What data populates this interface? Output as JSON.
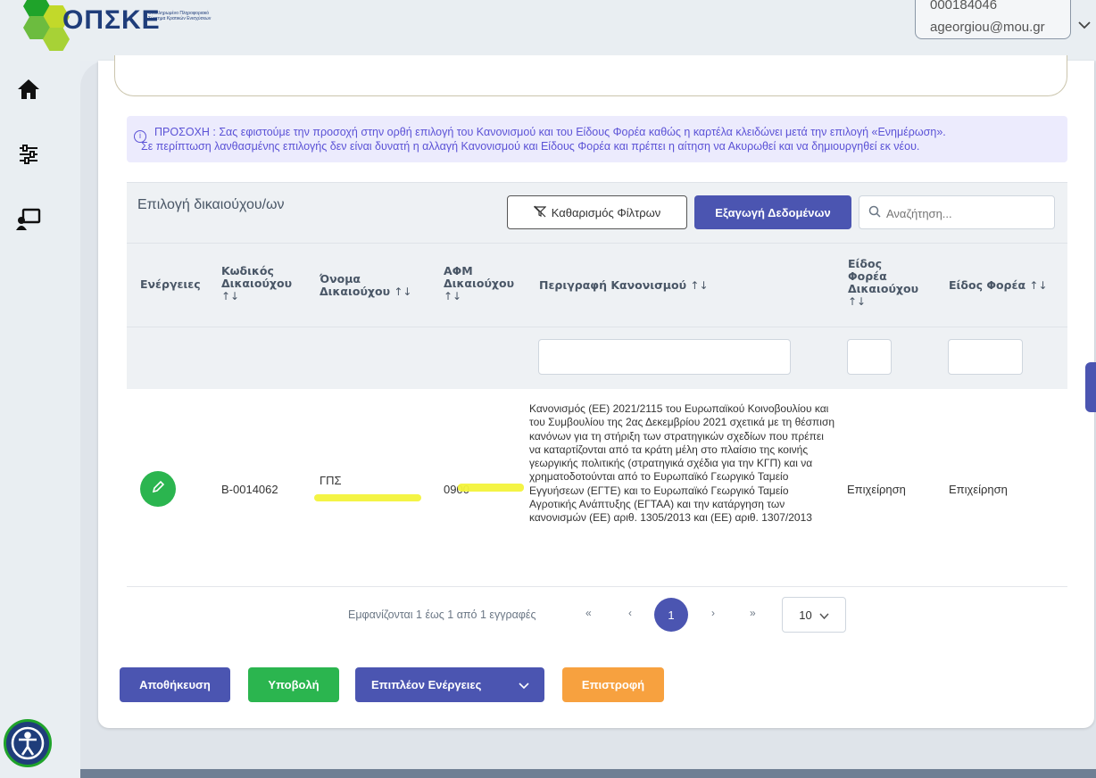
{
  "header": {
    "logo_text": "ΟΠΣΚΕ",
    "logo_subtitle": "Ολοκληρωμένο Πληροφοριακό Σύστημα Κρατικών Ενισχύσεων",
    "user_code": "000184046",
    "user_email": "ageorgiou@mou.gr"
  },
  "alert": {
    "line1": "ΠΡΟΣΟΧΗ : Σας εφιστούμε την προσοχή στην ορθή επιλογή του Κανονισμού και του Είδους Φορέα καθώς η καρτέλα κλειδώνει μετά την επιλογή «Ενημέρωση».",
    "line2": "Σε περίπτωση λανθασμένης επιλογής δεν είναι δυνατή η αλλαγή Κανονισμού και Είδους Φορέα και πρέπει η αίτηση να Ακυρωθεί και να δημιουργηθεί εκ νέου."
  },
  "table": {
    "title": "Επιλογή δικαιούχου/ων",
    "clear_filters": "Καθαρισμός Φίλτρων",
    "export": "Εξαγωγή Δεδομένων",
    "search_placeholder": "Αναζήτηση...",
    "sort_symbol": "↑↓",
    "columns": {
      "actions": "Ενέργειες",
      "code_l1": "Κωδικός",
      "code_l2": "Δικαιούχου",
      "name_l1": "Όνομα",
      "name_l2": "Δικαιούχου",
      "afm_l1": "ΑΦΜ",
      "afm_l2": "Δικαιούχου",
      "regulation": "Περιγραφή Κανονισμού",
      "entity_type_l1": "Είδος",
      "entity_type_l2": "Φορέα",
      "entity_type_l3": "Δικαιούχου",
      "body_type": "Είδος Φορέα"
    },
    "rows": [
      {
        "code": "B-0014062",
        "name": "ΓΠΣ",
        "afm": "0900",
        "regulation": "Κανονισμός (ΕΕ) 2021/2115 του Ευρωπαϊκού Κοινοβουλίου και του Συμβουλίου της 2ας Δεκεμβρίου 2021 σχετικά με τη θέσπιση κανόνων για τη στήριξη των στρατηγικών σχεδίων που πρέπει να καταρτίζονται από τα κράτη μέλη στο πλαίσιο της κοινής γεωργικής πολιτικής (στρατηγικά σχέδια για την ΚΓΠ) και να χρηματοδοτούνται από το Ευρωπαϊκό Γεωργικό Ταμείο Εγγυήσεων (ΕΓΤΕ) και το Ευρωπαϊκό Γεωργικό Ταμείο Αγροτικής Ανάπτυξης (ΕΓΤΑΑ) και την κατάργηση των κανονισμών (ΕΕ) αριθ. 1305/2013 και (ΕΕ) αριθ. 1307/2013",
        "entity_type": "Επιχείρηση",
        "body_type": "Επιχείρηση"
      }
    ]
  },
  "pagination": {
    "summary": "Εμφανίζονται 1 έως 1 από 1 εγγραφές",
    "first": "«",
    "prev": "‹",
    "current": "1",
    "next": "›",
    "last": "»",
    "page_size": "10"
  },
  "actions": {
    "save": "Αποθήκευση",
    "submit": "Υποβολή",
    "more": "Επιπλέον Ενέργειες",
    "back": "Επιστροφή"
  },
  "colors": {
    "primary": "#4b55b1",
    "success": "#2bb54f",
    "warning": "#f7a13f",
    "alert_text": "#5b52d6"
  }
}
